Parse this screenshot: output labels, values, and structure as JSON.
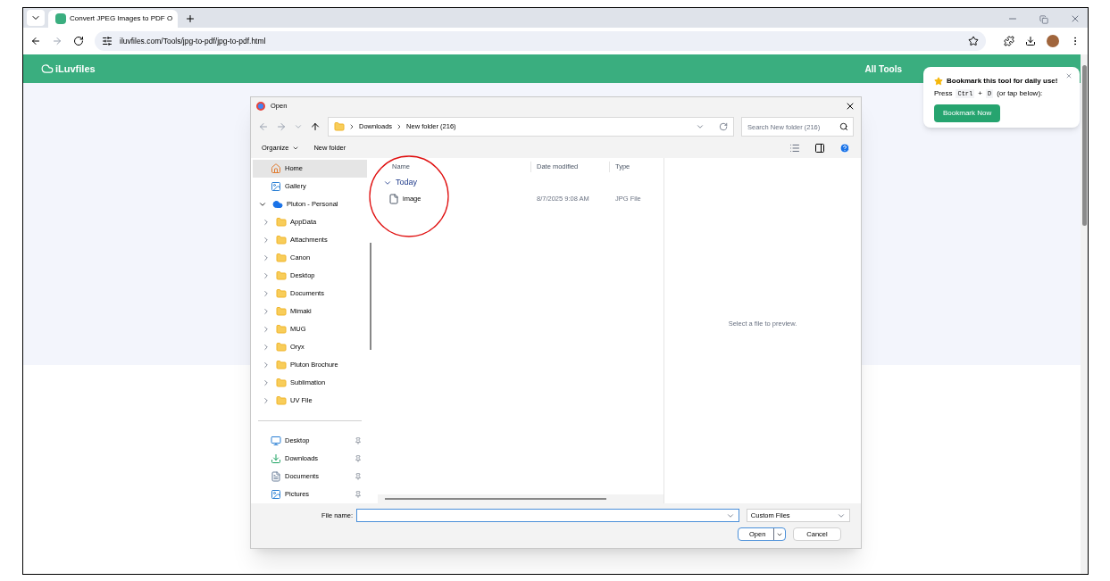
{
  "browser": {
    "tab_title": "Convert JPEG Images to PDF O",
    "url": "iluvfiles.com/Tools/jpg-to-pdf/jpg-to-pdf.html"
  },
  "site": {
    "logo": "iLuvfiles",
    "nav": [
      "All Tools"
    ]
  },
  "popup": {
    "message": "Bookmark this tool for daily use!",
    "press": "Press",
    "key1": "Ctrl",
    "plus": "+",
    "key2": "D",
    "hint": "(or tap below):",
    "button": "Bookmark Now"
  },
  "dialog": {
    "title": "Open",
    "breadcrumb": [
      "Downloads",
      "New folder (216)"
    ],
    "search_placeholder": "Search New folder (216)",
    "toolbar": [
      "Organize",
      "New folder"
    ],
    "places": [
      {
        "label": "Home",
        "selected": true
      },
      {
        "label": "Gallery",
        "selected": false
      }
    ],
    "tree": {
      "label": "Pluton - Personal",
      "expanded": true,
      "children": [
        {
          "label": "AppData",
          "expanded": false
        },
        {
          "label": "Attachments",
          "expanded": false
        },
        {
          "label": "Canon",
          "expanded": false
        },
        {
          "label": "Desktop",
          "expanded": false
        },
        {
          "label": "Documents",
          "expanded": false
        },
        {
          "label": "Mimaki",
          "expanded": false
        },
        {
          "label": "MUG",
          "expanded": false
        },
        {
          "label": "Oryx",
          "expanded": false
        },
        {
          "label": "Pluton Brochure",
          "expanded": false
        },
        {
          "label": "Sublimation",
          "expanded": false
        },
        {
          "label": "UV File",
          "expanded": false
        }
      ]
    },
    "quick_access": [
      {
        "label": "Desktop"
      },
      {
        "label": "Downloads"
      },
      {
        "label": "Documents"
      },
      {
        "label": "Pictures"
      }
    ],
    "columns": [
      "Name",
      "Date modified",
      "Type"
    ],
    "group": {
      "label": "Today",
      "expanded": true
    },
    "files": [
      {
        "name": "image",
        "date": "8/7/2025 9:08 AM",
        "type": "JPG File"
      }
    ],
    "preview": "Select a file to preview.",
    "file_name_label": "File name:",
    "file_type": "Custom Files",
    "buttons": [
      "Open",
      "Cancel"
    ]
  }
}
